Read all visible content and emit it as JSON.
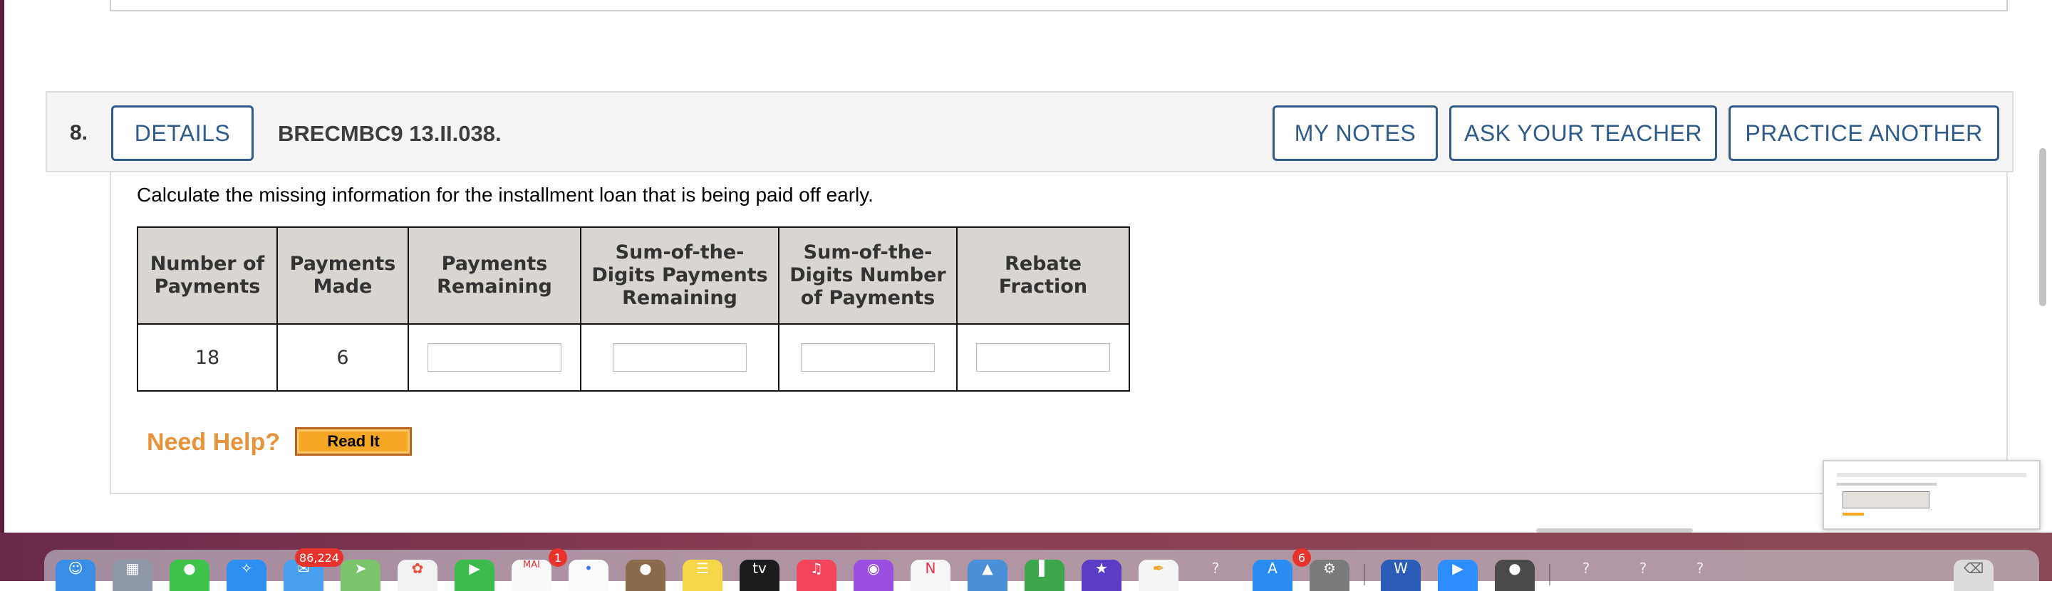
{
  "question": {
    "number": "8.",
    "code": "BRECMBC9 13.II.038.",
    "buttons": {
      "details": "DETAILS",
      "my_notes": "MY NOTES",
      "ask_teacher": "ASK YOUR TEACHER",
      "practice_another": "PRACTICE ANOTHER"
    },
    "instruction": "Calculate the missing information for the installment loan that is being paid off early.",
    "table": {
      "headers": [
        [
          "Number of",
          "Payments"
        ],
        [
          "Payments",
          "Made"
        ],
        [
          "Payments",
          "Remaining"
        ],
        [
          "Sum-of-the-",
          "Digits Payments",
          "Remaining"
        ],
        [
          "Sum-of-the-",
          "Digits Number",
          "of Payments"
        ],
        [
          "Rebate",
          "Fraction"
        ]
      ],
      "number_of_payments": "18",
      "payments_made": "6",
      "answers": {
        "payments_remaining": "",
        "sod_payments_remaining": "",
        "sod_number_of_payments": "",
        "rebate_fraction": ""
      }
    },
    "help": {
      "label": "Need Help?",
      "read_it": "Read It"
    }
  },
  "dock": {
    "mail_badge": "86,224",
    "calendar_month": "MAI",
    "calendar_badge": "1",
    "appstore_badge": "6",
    "tv_label": "tv"
  },
  "colors": {
    "accent": "#2e5b8a",
    "help_orange": "#e8923a",
    "given_value_red": "#d40000",
    "header_bg": "#d9d5d1"
  }
}
